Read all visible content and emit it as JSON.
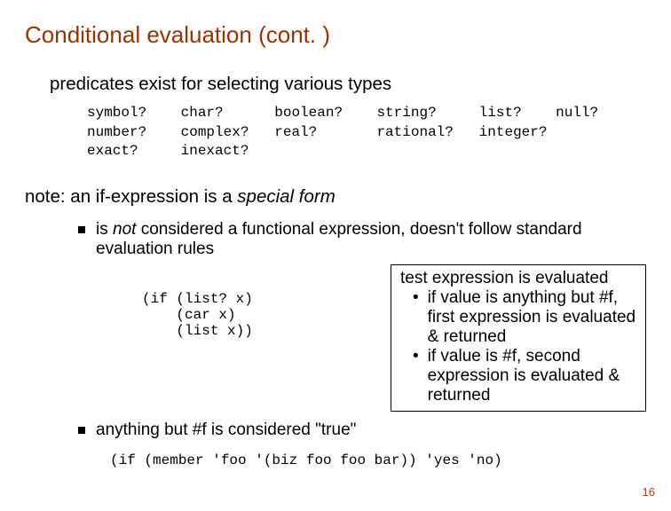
{
  "title": "Conditional evaluation (cont. )",
  "subhead": "predicates exist for selecting various types",
  "pred_block": "symbol?    char?      boolean?    string?     list?    null?\nnumber?    complex?   real?       rational?   integer?\nexact?     inexact?",
  "note_prefix": "note: an if-expression is a ",
  "note_italic": "special form",
  "bullet1_a": "is ",
  "bullet1_not": "not",
  "bullet1_b": " considered a functional expression, doesn't follow standard evaluation rules",
  "code_if": "(if (list? x)\n    (car x)\n    (list x))",
  "box_head": "test expression is evaluated",
  "box_item1": "if value is anything but #f, first expression is evaluated & returned",
  "box_item2": "if value is #f, second expression is evaluated & returned",
  "bullet2": "anything but #f is considered \"true\"",
  "bottom_code": "(if (member 'foo '(biz foo foo bar)) 'yes 'no)",
  "page_number": "16"
}
